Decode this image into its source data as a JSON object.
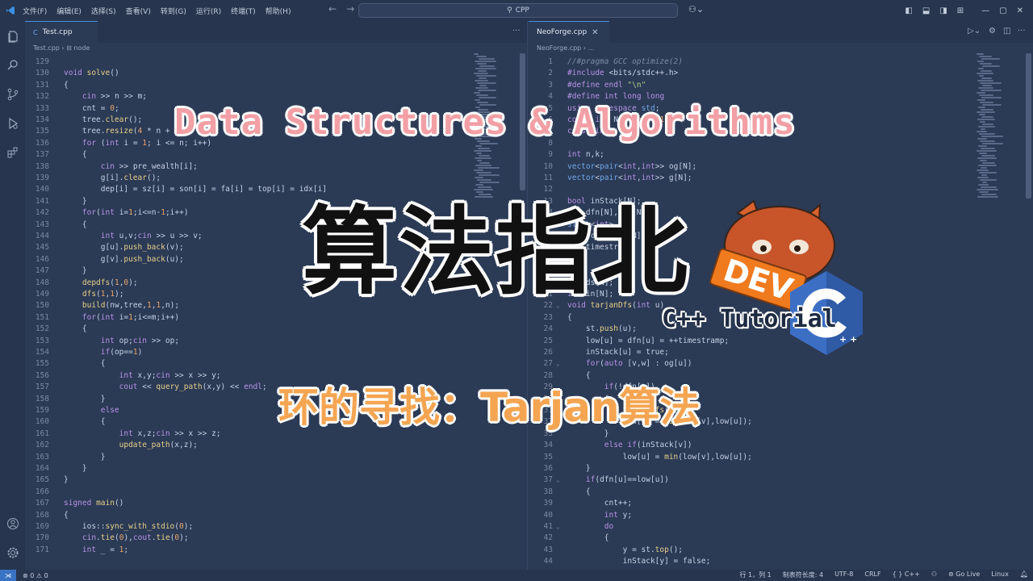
{
  "titlebar": {
    "menu": [
      "文件(F)",
      "编辑(E)",
      "选择(S)",
      "查看(V)",
      "转到(G)",
      "运行(R)",
      "终端(T)",
      "帮助(H)"
    ],
    "search": "CPP"
  },
  "left_editor": {
    "tab": "Test.cpp",
    "breadcrumb": [
      "Test.cpp",
      "node"
    ],
    "lines": [
      {
        "n": "129",
        "t": ""
      },
      {
        "n": "130",
        "t": "void solve()"
      },
      {
        "n": "131",
        "t": "{"
      },
      {
        "n": "132",
        "t": "    cin >> n >> m;"
      },
      {
        "n": "133",
        "t": "    cnt = 0;"
      },
      {
        "n": "134",
        "t": "    tree.clear();"
      },
      {
        "n": "135",
        "t": "    tree.resize(4 * n + 5);"
      },
      {
        "n": "136",
        "t": "    for (int i = 1; i <= n; i++)"
      },
      {
        "n": "137",
        "t": "    {"
      },
      {
        "n": "138",
        "t": "        cin >> pre_wealth[i];"
      },
      {
        "n": "139",
        "t": "        g[i].clear();"
      },
      {
        "n": "140",
        "t": "        dep[i] = sz[i] = son[i] = fa[i] = top[i] = idx[i]"
      },
      {
        "n": "141",
        "t": "    }"
      },
      {
        "n": "142",
        "t": "    for(int i=1;i<=n-1;i++)"
      },
      {
        "n": "143",
        "t": "    {"
      },
      {
        "n": "144",
        "t": "        int u,v;cin >> u >> v;"
      },
      {
        "n": "145",
        "t": "        g[u].push_back(v);"
      },
      {
        "n": "146",
        "t": "        g[v].push_back(u);"
      },
      {
        "n": "147",
        "t": "    }"
      },
      {
        "n": "148",
        "t": "    depdfs(1,0);"
      },
      {
        "n": "149",
        "t": "    dfs(1,1);"
      },
      {
        "n": "150",
        "t": "    build(nw,tree,1,1,n);"
      },
      {
        "n": "151",
        "t": "    for(int i=1;i<=m;i++)"
      },
      {
        "n": "152",
        "t": "    {"
      },
      {
        "n": "153",
        "t": "        int op;cin >> op;"
      },
      {
        "n": "154",
        "t": "        if(op==1)"
      },
      {
        "n": "155",
        "t": "        {"
      },
      {
        "n": "156",
        "t": "            int x,y;cin >> x >> y;"
      },
      {
        "n": "157",
        "t": "            cout << query_path(x,y) << endl;"
      },
      {
        "n": "158",
        "t": "        }"
      },
      {
        "n": "159",
        "t": "        else"
      },
      {
        "n": "160",
        "t": "        {"
      },
      {
        "n": "161",
        "t": "            int x,z;cin >> x >> z;"
      },
      {
        "n": "162",
        "t": "            update_path(x,z);"
      },
      {
        "n": "163",
        "t": "        }"
      },
      {
        "n": "164",
        "t": "    }"
      },
      {
        "n": "165",
        "t": "}"
      },
      {
        "n": "166",
        "t": ""
      },
      {
        "n": "167",
        "t": "signed main()"
      },
      {
        "n": "168",
        "t": "{"
      },
      {
        "n": "169",
        "t": "    ios::sync_with_stdio(0);"
      },
      {
        "n": "170",
        "t": "    cin.tie(0),cout.tie(0);"
      },
      {
        "n": "171",
        "t": "    int _ = 1;"
      }
    ]
  },
  "right_editor": {
    "tab": "NeoForge.cpp",
    "breadcrumb": [
      "NeoForge.cpp",
      "..."
    ],
    "lines": [
      {
        "n": "1",
        "t": "//#pragma GCC optimize(2)"
      },
      {
        "n": "2",
        "t": "#include <bits/stdc++.h>"
      },
      {
        "n": "3",
        "t": "#define endl \"\\n\""
      },
      {
        "n": "4",
        "t": "#define int long long"
      },
      {
        "n": "5",
        "t": "using namespace std;"
      },
      {
        "n": "6",
        "t": "const int N = 1e5 + 10;"
      },
      {
        "n": "7",
        "t": "const int"
      },
      {
        "n": "8",
        "t": ""
      },
      {
        "n": "9",
        "t": "int n,k;"
      },
      {
        "n": "10",
        "t": "vector<pair<int,int>> og[N];"
      },
      {
        "n": "11",
        "t": "vector<pair<int,int>> g[N];"
      },
      {
        "n": "12",
        "t": ""
      },
      {
        "n": "13",
        "t": "bool inStack[N];"
      },
      {
        "n": "14",
        "t": "int dfn[N],low[N];"
      },
      {
        "n": "15",
        "t": "stack<int> st;"
      },
      {
        "n": "16",
        "t": "int scc[N],sz[N];"
      },
      {
        "n": "17",
        "t": "int timestramp;"
      },
      {
        "n": "18",
        "t": ""
      },
      {
        "n": "19",
        "t": ""
      },
      {
        "n": "20",
        "t": "int ds[N];"
      },
      {
        "n": "21",
        "t": "int in[N];"
      },
      {
        "n": "22",
        "t": "void tarjanDfs(int u)"
      },
      {
        "n": "23",
        "t": "{"
      },
      {
        "n": "24",
        "t": "    st.push(u);"
      },
      {
        "n": "25",
        "t": "    low[u] = dfn[u] = ++timestramp;"
      },
      {
        "n": "26",
        "t": "    inStack[u] = true;"
      },
      {
        "n": "27",
        "t": "    for(auto [v,w] : og[u])"
      },
      {
        "n": "28",
        "t": "    {"
      },
      {
        "n": "29",
        "t": "        if(!dfn[v])"
      },
      {
        "n": "30",
        "t": "        {"
      },
      {
        "n": "31",
        "t": "            tarjanDfs(v);"
      },
      {
        "n": "32",
        "t": "            low[u] = min(low[v],low[u]);"
      },
      {
        "n": "33",
        "t": "        }"
      },
      {
        "n": "34",
        "t": "        else if(inStack[v])"
      },
      {
        "n": "35",
        "t": "            low[u] = min(low[v],low[u]);"
      },
      {
        "n": "36",
        "t": "    }"
      },
      {
        "n": "37",
        "t": "    if(dfn[u]==low[u])"
      },
      {
        "n": "38",
        "t": "    {"
      },
      {
        "n": "39",
        "t": "        cnt++;"
      },
      {
        "n": "40",
        "t": "        int y;"
      },
      {
        "n": "41",
        "t": "        do"
      },
      {
        "n": "42",
        "t": "        {"
      },
      {
        "n": "43",
        "t": "            y = st.top();"
      },
      {
        "n": "44",
        "t": "            inStack[y] = false;"
      }
    ]
  },
  "overlay": {
    "en_title": "Data Structures & Algorithms",
    "cn_title": "算法指北",
    "tutorial": "C++ Tutorial",
    "subtitle": "环的寻找：Tarjan算法",
    "badge_text": "DEV"
  },
  "statusbar": {
    "problems": "⊗ 0 ⚠ 0",
    "position": "行 1，列 1",
    "tab_size": "制表符长度: 4",
    "encoding": "UTF-8",
    "eol": "CRLF",
    "language": "C++",
    "golive": "Go Live",
    "os": "Linux"
  },
  "colors": {
    "accent": "#4d8fe0",
    "background": "#2b3a55",
    "title_pink": "#f29fa5",
    "subtitle_orange": "#f5a552"
  }
}
